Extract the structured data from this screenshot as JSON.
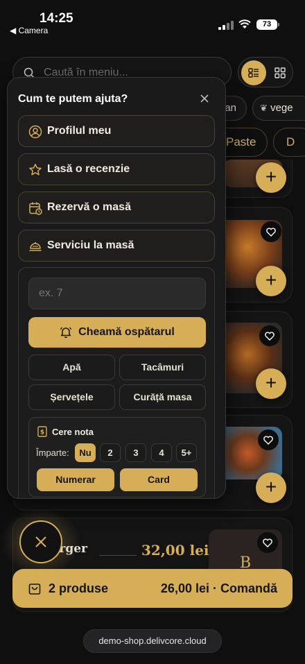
{
  "status_bar": {
    "time": "14:25",
    "back_label": "◀ Camera",
    "battery": "73"
  },
  "search": {
    "placeholder": "Caută în meniu..."
  },
  "filter_chips": [
    "an",
    "vege"
  ],
  "categories": [
    "Paste",
    "D"
  ],
  "help_menu": {
    "title": "Cum te putem ajuta?",
    "options": [
      {
        "label": "Profilul meu",
        "icon": "user-circle-icon"
      },
      {
        "label": "Lasă o recenzie",
        "icon": "star-icon"
      },
      {
        "label": "Rezervă o masă",
        "icon": "calendar-clock-icon"
      },
      {
        "label": "Serviciu la masă",
        "icon": "cloche-icon"
      }
    ],
    "table_placeholder": "ex. 7",
    "call_waiter_label": "Cheamă ospătarul",
    "requests": [
      "Apă",
      "Tacâmuri",
      "Șervețele",
      "Curăță masa"
    ],
    "bill": {
      "title": "Cere nota",
      "split_label": "Împarte:",
      "split_options": [
        "Nu",
        "2",
        "3",
        "4",
        "5+"
      ],
      "split_selected": "Nu",
      "payment_options": [
        "Numerar",
        "Card"
      ]
    }
  },
  "product_partial": {
    "name": "urger",
    "price": "32,00 lei",
    "placeholder_letter": "B"
  },
  "cart": {
    "count_label": "2 produse",
    "total_label": "26,00 lei · Comandă"
  },
  "url": "demo-shop.delivcore.cloud",
  "colors": {
    "accent": "#d5ae57",
    "background": "#0f0f10",
    "panel": "#1a1a1a"
  }
}
